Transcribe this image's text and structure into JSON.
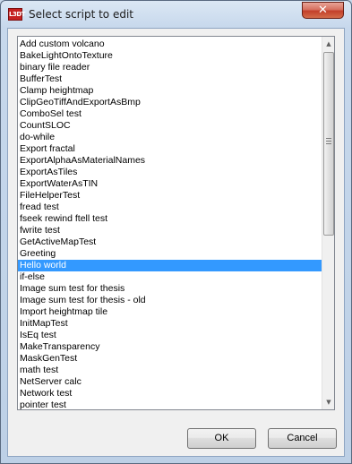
{
  "window": {
    "title": "Select script to edit",
    "app_icon_text": "L3DT",
    "close_glyph": "✕"
  },
  "scripts": [
    "Add custom volcano",
    "BakeLightOntoTexture",
    "binary file reader",
    "BufferTest",
    "Clamp heightmap",
    "ClipGeoTiffAndExportAsBmp",
    "ComboSel test",
    "CountSLOC",
    "do-while",
    "Export fractal",
    "ExportAlphaAsMaterialNames",
    "ExportAsTiles",
    "ExportWaterAsTIN",
    "FileHelperTest",
    "fread test",
    "fseek rewind ftell test",
    "fwrite test",
    "GetActiveMapTest",
    "Greeting",
    "Hello world",
    "if-else",
    "Image sum test for thesis",
    "Image sum test for thesis - old",
    "Import heightmap tile",
    "InitMapTest",
    "IsEq test",
    "MakeTransparency",
    "MaskGenTest",
    "math test",
    "NetServer calc",
    "Network test",
    "pointer test"
  ],
  "selected_script": "Hello world",
  "scrollbar": {
    "up_icon": "▲",
    "down_icon": "▼"
  },
  "buttons": {
    "ok_label": "OK",
    "cancel_label": "Cancel"
  },
  "colors": {
    "selection": "#3399ff",
    "close_button": "#c3402a"
  }
}
